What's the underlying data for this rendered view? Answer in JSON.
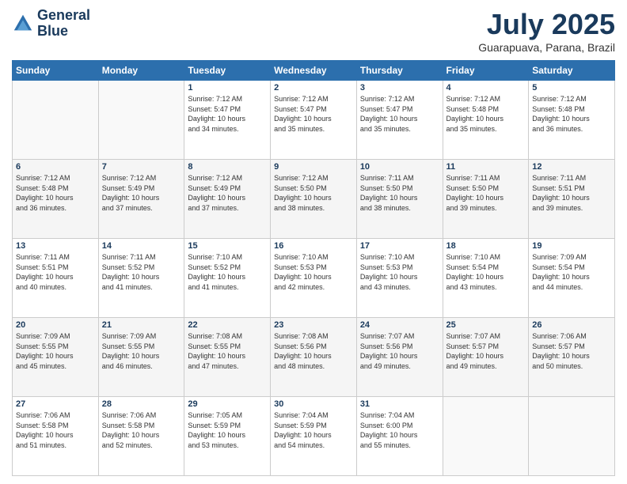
{
  "logo": {
    "line1": "General",
    "line2": "Blue"
  },
  "title": "July 2025",
  "location": "Guarapuava, Parana, Brazil",
  "days_of_week": [
    "Sunday",
    "Monday",
    "Tuesday",
    "Wednesday",
    "Thursday",
    "Friday",
    "Saturday"
  ],
  "weeks": [
    [
      {
        "day": "",
        "info": ""
      },
      {
        "day": "",
        "info": ""
      },
      {
        "day": "1",
        "info": "Sunrise: 7:12 AM\nSunset: 5:47 PM\nDaylight: 10 hours\nand 34 minutes."
      },
      {
        "day": "2",
        "info": "Sunrise: 7:12 AM\nSunset: 5:47 PM\nDaylight: 10 hours\nand 35 minutes."
      },
      {
        "day": "3",
        "info": "Sunrise: 7:12 AM\nSunset: 5:47 PM\nDaylight: 10 hours\nand 35 minutes."
      },
      {
        "day": "4",
        "info": "Sunrise: 7:12 AM\nSunset: 5:48 PM\nDaylight: 10 hours\nand 35 minutes."
      },
      {
        "day": "5",
        "info": "Sunrise: 7:12 AM\nSunset: 5:48 PM\nDaylight: 10 hours\nand 36 minutes."
      }
    ],
    [
      {
        "day": "6",
        "info": "Sunrise: 7:12 AM\nSunset: 5:48 PM\nDaylight: 10 hours\nand 36 minutes."
      },
      {
        "day": "7",
        "info": "Sunrise: 7:12 AM\nSunset: 5:49 PM\nDaylight: 10 hours\nand 37 minutes."
      },
      {
        "day": "8",
        "info": "Sunrise: 7:12 AM\nSunset: 5:49 PM\nDaylight: 10 hours\nand 37 minutes."
      },
      {
        "day": "9",
        "info": "Sunrise: 7:12 AM\nSunset: 5:50 PM\nDaylight: 10 hours\nand 38 minutes."
      },
      {
        "day": "10",
        "info": "Sunrise: 7:11 AM\nSunset: 5:50 PM\nDaylight: 10 hours\nand 38 minutes."
      },
      {
        "day": "11",
        "info": "Sunrise: 7:11 AM\nSunset: 5:50 PM\nDaylight: 10 hours\nand 39 minutes."
      },
      {
        "day": "12",
        "info": "Sunrise: 7:11 AM\nSunset: 5:51 PM\nDaylight: 10 hours\nand 39 minutes."
      }
    ],
    [
      {
        "day": "13",
        "info": "Sunrise: 7:11 AM\nSunset: 5:51 PM\nDaylight: 10 hours\nand 40 minutes."
      },
      {
        "day": "14",
        "info": "Sunrise: 7:11 AM\nSunset: 5:52 PM\nDaylight: 10 hours\nand 41 minutes."
      },
      {
        "day": "15",
        "info": "Sunrise: 7:10 AM\nSunset: 5:52 PM\nDaylight: 10 hours\nand 41 minutes."
      },
      {
        "day": "16",
        "info": "Sunrise: 7:10 AM\nSunset: 5:53 PM\nDaylight: 10 hours\nand 42 minutes."
      },
      {
        "day": "17",
        "info": "Sunrise: 7:10 AM\nSunset: 5:53 PM\nDaylight: 10 hours\nand 43 minutes."
      },
      {
        "day": "18",
        "info": "Sunrise: 7:10 AM\nSunset: 5:54 PM\nDaylight: 10 hours\nand 43 minutes."
      },
      {
        "day": "19",
        "info": "Sunrise: 7:09 AM\nSunset: 5:54 PM\nDaylight: 10 hours\nand 44 minutes."
      }
    ],
    [
      {
        "day": "20",
        "info": "Sunrise: 7:09 AM\nSunset: 5:55 PM\nDaylight: 10 hours\nand 45 minutes."
      },
      {
        "day": "21",
        "info": "Sunrise: 7:09 AM\nSunset: 5:55 PM\nDaylight: 10 hours\nand 46 minutes."
      },
      {
        "day": "22",
        "info": "Sunrise: 7:08 AM\nSunset: 5:55 PM\nDaylight: 10 hours\nand 47 minutes."
      },
      {
        "day": "23",
        "info": "Sunrise: 7:08 AM\nSunset: 5:56 PM\nDaylight: 10 hours\nand 48 minutes."
      },
      {
        "day": "24",
        "info": "Sunrise: 7:07 AM\nSunset: 5:56 PM\nDaylight: 10 hours\nand 49 minutes."
      },
      {
        "day": "25",
        "info": "Sunrise: 7:07 AM\nSunset: 5:57 PM\nDaylight: 10 hours\nand 49 minutes."
      },
      {
        "day": "26",
        "info": "Sunrise: 7:06 AM\nSunset: 5:57 PM\nDaylight: 10 hours\nand 50 minutes."
      }
    ],
    [
      {
        "day": "27",
        "info": "Sunrise: 7:06 AM\nSunset: 5:58 PM\nDaylight: 10 hours\nand 51 minutes."
      },
      {
        "day": "28",
        "info": "Sunrise: 7:06 AM\nSunset: 5:58 PM\nDaylight: 10 hours\nand 52 minutes."
      },
      {
        "day": "29",
        "info": "Sunrise: 7:05 AM\nSunset: 5:59 PM\nDaylight: 10 hours\nand 53 minutes."
      },
      {
        "day": "30",
        "info": "Sunrise: 7:04 AM\nSunset: 5:59 PM\nDaylight: 10 hours\nand 54 minutes."
      },
      {
        "day": "31",
        "info": "Sunrise: 7:04 AM\nSunset: 6:00 PM\nDaylight: 10 hours\nand 55 minutes."
      },
      {
        "day": "",
        "info": ""
      },
      {
        "day": "",
        "info": ""
      }
    ]
  ]
}
